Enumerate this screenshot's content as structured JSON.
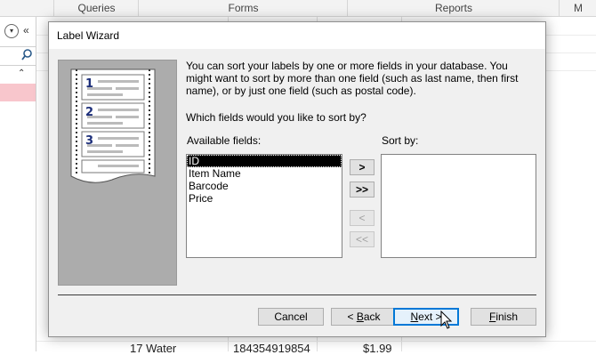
{
  "ribbon": {
    "tabs": [
      "Queries",
      "Forms",
      "Reports",
      "M"
    ]
  },
  "nav": {
    "collapse_glyph": "«",
    "dropdown_glyph": "▾",
    "up_glyph": "⌃"
  },
  "background_row": {
    "id_name": "17 Water",
    "barcode": "184354919854",
    "price": "$1.99"
  },
  "dialog": {
    "title": "Label Wizard",
    "intro": "You can sort your labels by one or more fields in your database.  You might want to sort by more than one field (such as last name, then first name), or by just one field (such as postal code).",
    "question": "Which fields would you like to sort by?",
    "available_label": "Available fields:",
    "sortby_label": "Sort by:",
    "available_fields": [
      "ID",
      "Item Name",
      "Barcode",
      "Price"
    ],
    "selected_field": "ID",
    "sort_fields": [],
    "move_buttons": {
      "add_one": ">",
      "add_all": ">>",
      "remove_one": "<",
      "remove_all": "<<"
    },
    "label_numbers": [
      "1",
      "2",
      "3"
    ],
    "buttons": {
      "cancel": "Cancel",
      "back_prefix": "< ",
      "back_ul": "B",
      "back_rest": "ack",
      "next_ul": "N",
      "next_rest": "ext >",
      "finish_ul": "F",
      "finish_rest": "inish"
    }
  }
}
